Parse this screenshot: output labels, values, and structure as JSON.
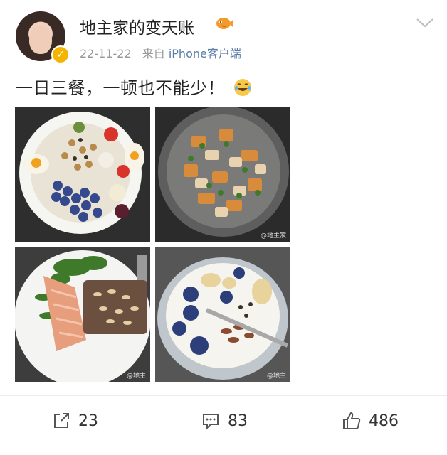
{
  "post": {
    "author": "地主家的变天账",
    "time": "22-11-22",
    "source_prefix": "来自",
    "source_device": "iPhone客户端",
    "text": "一日三餐，一顿也不能少！",
    "verified_color": "#f4b400"
  },
  "photos": [
    {
      "name": "salad-plate-photo"
    },
    {
      "name": "stir-fry-pan-photo"
    },
    {
      "name": "salmon-toast-photo"
    },
    {
      "name": "yogurt-bowl-photo"
    }
  ],
  "actions": {
    "share_count": "23",
    "comment_count": "83",
    "like_count": "486"
  }
}
